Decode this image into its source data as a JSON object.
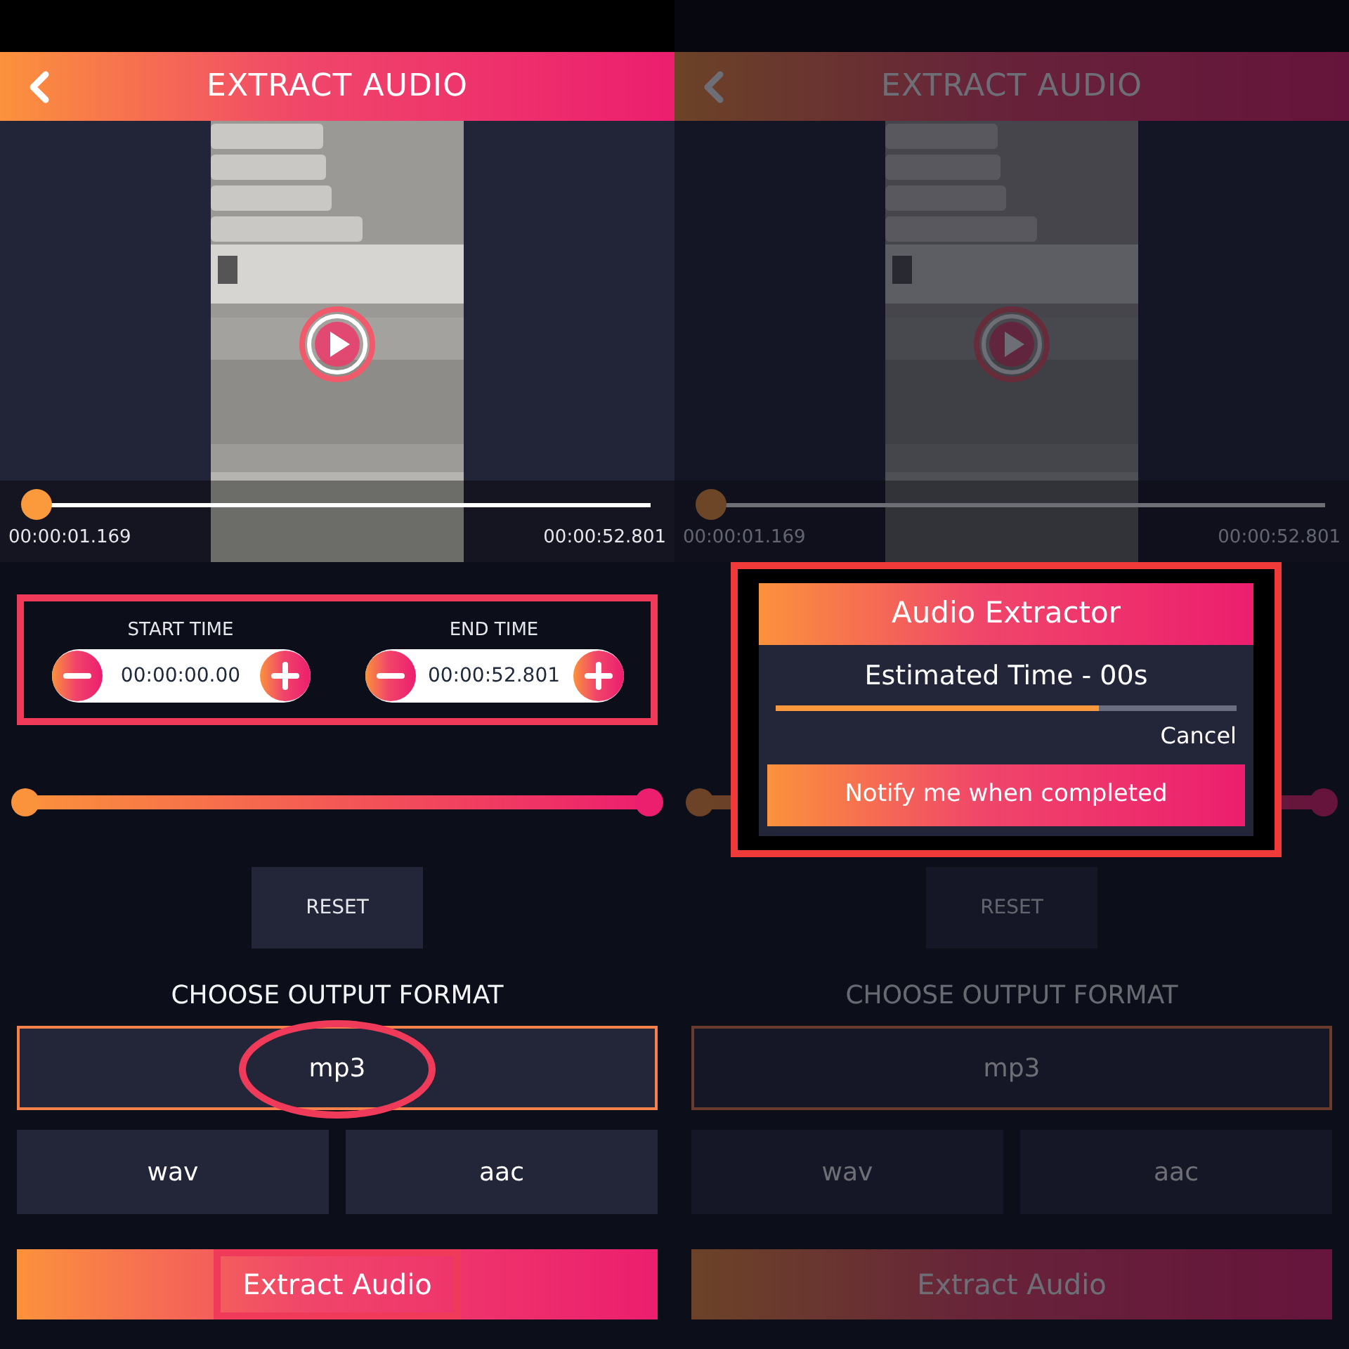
{
  "panels": [
    {
      "dimmed": false,
      "header": {
        "title": "EXTRACT AUDIO"
      },
      "player": {
        "level": 0.02,
        "current": "00:00:01.169",
        "duration": "00:00:52.801"
      },
      "trim": {
        "marked": true,
        "start": {
          "label": "START TIME",
          "value": "00:00:00.00"
        },
        "end": {
          "label": "END TIME",
          "value": "00:00:52.801"
        }
      },
      "range": {
        "start": {
          "level": 0
        },
        "end": {
          "level": 1
        }
      },
      "reset": "RESET",
      "format_heading": "CHOOSE OUTPUT FORMAT",
      "formats": [
        {
          "label": "mp3",
          "selected": true,
          "circled": true
        },
        {
          "label": "wav",
          "selected": false,
          "circled": false
        },
        {
          "label": "aac",
          "selected": false,
          "circled": false
        }
      ],
      "extract": {
        "label": "Extract Audio",
        "marked": true
      }
    },
    {
      "dimmed": true,
      "header": {
        "title": "EXTRACT AUDIO"
      },
      "player": {
        "level": 0.02,
        "current": "00:00:01.169",
        "duration": "00:00:52.801"
      },
      "range": {
        "start": {
          "level": 0
        },
        "end": {
          "level": 1
        }
      },
      "reset": "RESET",
      "format_heading": "CHOOSE OUTPUT FORMAT",
      "formats": [
        {
          "label": "mp3",
          "selected": true,
          "circled": false
        },
        {
          "label": "wav",
          "selected": false,
          "circled": false
        },
        {
          "label": "aac",
          "selected": false,
          "circled": false
        }
      ],
      "extract": {
        "label": "Extract Audio",
        "marked": false
      },
      "dialog": {
        "marked": true,
        "title": "Audio Extractor",
        "message": "Estimated Time - 00s",
        "progress": {
          "level": 0.7
        },
        "cancel": "Cancel",
        "notify": "Notify me when completed"
      }
    }
  ]
}
